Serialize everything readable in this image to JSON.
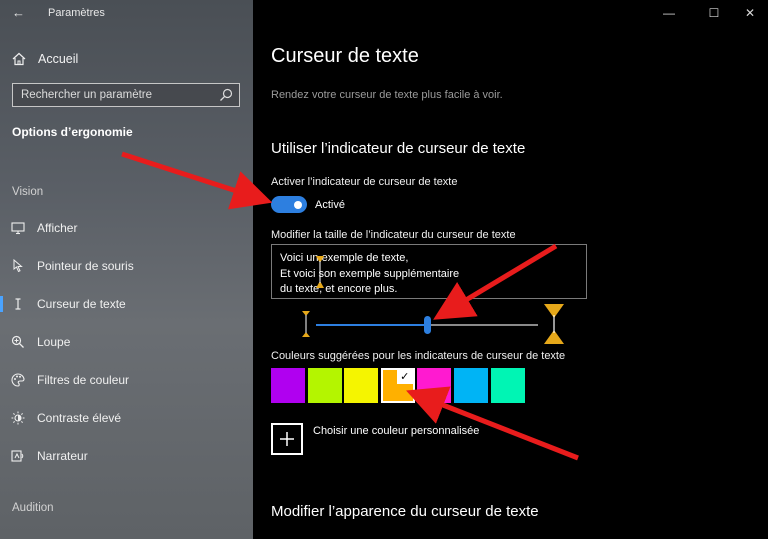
{
  "window": {
    "title": "Paramètres"
  },
  "sidebar": {
    "home_label": "Accueil",
    "search_placeholder": "Rechercher un paramètre",
    "section_title": "Options d’ergonomie",
    "group_vision": "Vision",
    "items": [
      {
        "label": "Afficher",
        "icon": "monitor-icon"
      },
      {
        "label": "Pointeur de souris",
        "icon": "mouse-pointer-icon"
      },
      {
        "label": "Curseur de texte",
        "icon": "text-cursor-icon",
        "active": true
      },
      {
        "label": "Loupe",
        "icon": "magnifier-icon"
      },
      {
        "label": "Filtres de couleur",
        "icon": "palette-icon"
      },
      {
        "label": "Contraste élevé",
        "icon": "contrast-icon"
      },
      {
        "label": "Narrateur",
        "icon": "narrator-icon"
      }
    ],
    "group_audition": "Audition"
  },
  "main": {
    "title": "Curseur de texte",
    "description": "Rendez votre curseur de texte plus facile à voir.",
    "section1_title": "Utiliser l’indicateur de curseur de texte",
    "toggle_label": "Activer l’indicateur de curseur de texte",
    "toggle_state": "Activé",
    "toggle_on": true,
    "size_label": "Modifier la taille de l’indicateur du curseur de texte",
    "sample_lines": [
      "Voici un exemple de texte,",
      "Et voici son exemple supplémentaire",
      "du texte, et encore plus."
    ],
    "slider_value": 0.5,
    "colors_label": "Couleurs suggérées pour les indicateurs de curseur de texte",
    "colors": [
      "#b000f0",
      "#b4f500",
      "#f5f500",
      "#ffb000",
      "#ff1ad0",
      "#00b4f5",
      "#00f5b4"
    ],
    "selected_color_index": 3,
    "custom_color_label": "Choisir une couleur personnalisée",
    "section2_title": "Modifier l’apparence du curseur de texte",
    "accent_color": "#2d7fe0",
    "annotation_arrow_color": "#e81c1c"
  }
}
